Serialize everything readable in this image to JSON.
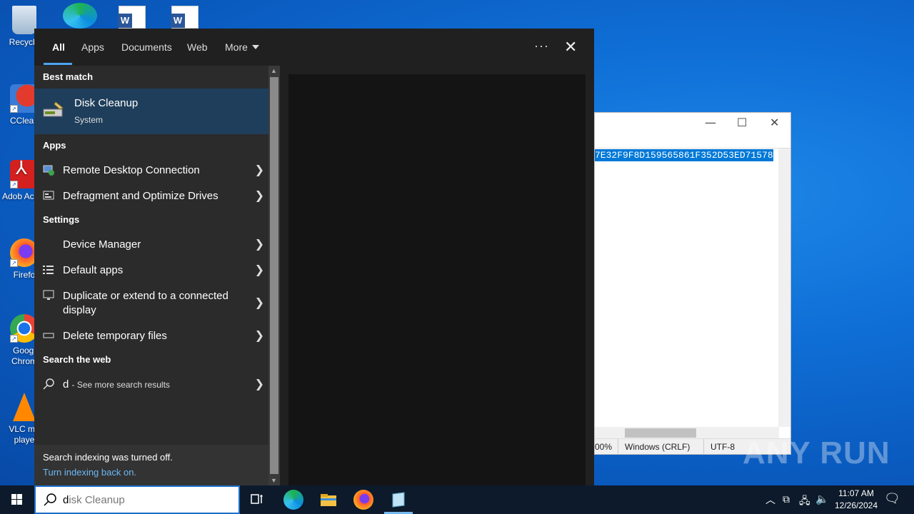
{
  "desktop": {
    "icons": [
      {
        "label": "Recycle",
        "kind": "recycle-bin"
      },
      {
        "label": "CClean",
        "kind": "ccleaner"
      },
      {
        "label": "Adob Acrob",
        "kind": "acrobat"
      },
      {
        "label": "Firefo",
        "kind": "firefox"
      },
      {
        "label": "Googl Chrom",
        "kind": "chrome"
      },
      {
        "label": "VLC me playe",
        "kind": "vlc"
      }
    ]
  },
  "notepad": {
    "selected_text": "7E32F9F8D159565861F352D53ED71578",
    "status": {
      "zoom": "00%",
      "line_ending": "Windows (CRLF)",
      "encoding": "UTF-8"
    }
  },
  "search": {
    "tabs": [
      {
        "label": "All",
        "active": true
      },
      {
        "label": "Apps",
        "active": false
      },
      {
        "label": "Documents",
        "active": false
      },
      {
        "label": "Web",
        "active": false
      },
      {
        "label": "More",
        "active": false
      }
    ],
    "sections": {
      "best_match": "Best match",
      "apps": "Apps",
      "settings": "Settings",
      "web": "Search the web"
    },
    "best_match": {
      "name": "Disk Cleanup",
      "subtitle": "System",
      "icon": "disk-cleanup-icon"
    },
    "apps": [
      {
        "label": "Remote Desktop Connection",
        "icon": "remote-desktop-icon"
      },
      {
        "label": "Defragment and Optimize Drives",
        "icon": "defrag-icon"
      }
    ],
    "settings": [
      {
        "label": "Device Manager",
        "icon": "device-manager-icon"
      },
      {
        "label": "Default apps",
        "icon": "default-apps-icon"
      },
      {
        "label": "Duplicate or extend to a connected display",
        "icon": "monitor-icon"
      },
      {
        "label": "Delete temporary files",
        "icon": "storage-icon"
      }
    ],
    "web_result": {
      "query": "d",
      "suffix": "- See more search results"
    },
    "indexing": {
      "message": "Search indexing was turned off.",
      "link": "Turn indexing back on."
    },
    "query_typed": "d",
    "query_completion": "isk Cleanup"
  },
  "taskbar": {
    "time": "11:07 AM",
    "date": "12/26/2024"
  },
  "watermark": "ANY RUN",
  "colors": {
    "accent": "#4ca4f0",
    "best_match_bg": "#1f3e5b",
    "panel_bg": "#202020"
  }
}
